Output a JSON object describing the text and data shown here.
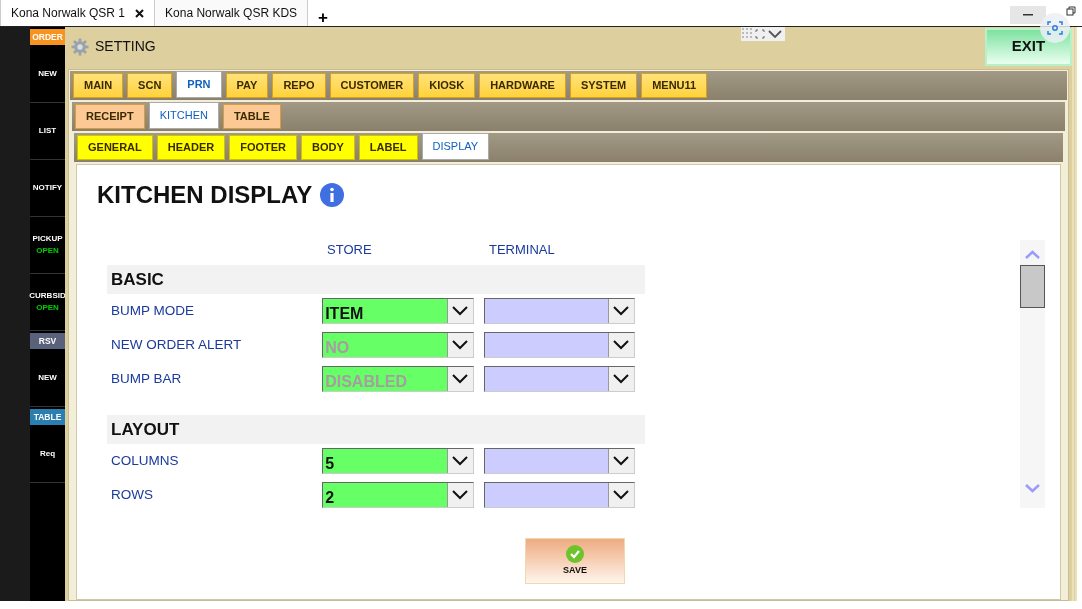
{
  "browser_tabs": [
    {
      "label": "Kona Norwalk QSR 1",
      "selected": true,
      "closable": true
    },
    {
      "label": "Kona Norwalk QSR KDS",
      "selected": false,
      "closable": false
    }
  ],
  "new_tab": "+",
  "sidebar": [
    {
      "label": "ORDER",
      "kind": "tag",
      "color": "#f7931e"
    },
    {
      "label": "NEW",
      "kind": "item"
    },
    {
      "label": "LIST",
      "kind": "item"
    },
    {
      "label": "NOTIFY",
      "kind": "item"
    },
    {
      "label": "PICKUP",
      "kind": "item",
      "sub": "OPEN"
    },
    {
      "label": "CURBSID",
      "kind": "item",
      "sub": "OPEN"
    },
    {
      "label": "RSV",
      "kind": "tag",
      "color": "#59627a"
    },
    {
      "label": "NEW",
      "kind": "item"
    },
    {
      "label": "TABLE",
      "kind": "tag",
      "color": "#2a7fb0"
    },
    {
      "label": "Req",
      "kind": "item"
    }
  ],
  "header": {
    "title": "SETTING",
    "exit": "EXIT"
  },
  "tabs": [
    {
      "label": "MAIN",
      "selected": false
    },
    {
      "label": "SCN",
      "selected": false
    },
    {
      "label": "PRN",
      "selected": true
    },
    {
      "label": "PAY",
      "selected": false
    },
    {
      "label": "REPO",
      "selected": false
    },
    {
      "label": "CUSTOMER",
      "selected": false
    },
    {
      "label": "KIOSK",
      "selected": false
    },
    {
      "label": "HARDWARE",
      "selected": false
    },
    {
      "label": "SYSTEM",
      "selected": false
    },
    {
      "label": "MENU11",
      "selected": false
    }
  ],
  "subtabs": [
    {
      "label": "RECEIPT",
      "selected": false
    },
    {
      "label": "KITCHEN",
      "selected": true
    },
    {
      "label": "TABLE",
      "selected": false
    }
  ],
  "section_tabs": [
    {
      "label": "GENERAL",
      "selected": false
    },
    {
      "label": "HEADER",
      "selected": false
    },
    {
      "label": "FOOTER",
      "selected": false
    },
    {
      "label": "BODY",
      "selected": false
    },
    {
      "label": "LABEL",
      "selected": false
    },
    {
      "label": "DISPLAY",
      "selected": true
    }
  ],
  "page_title": "KITCHEN DISPLAY",
  "columns": [
    "STORE",
    "TERMINAL"
  ],
  "sections": [
    {
      "title": "BASIC",
      "rows": [
        {
          "label": "BUMP MODE",
          "store": "ITEM",
          "dimmed": false
        },
        {
          "label": "NEW ORDER ALERT",
          "store": "NO",
          "dimmed": true
        },
        {
          "label": "BUMP BAR",
          "store": "DISABLED",
          "dimmed": true
        }
      ]
    },
    {
      "title": "LAYOUT",
      "rows": [
        {
          "label": "COLUMNS",
          "store": "5",
          "dimmed": false
        },
        {
          "label": "ROWS",
          "store": "2",
          "dimmed": false
        }
      ]
    }
  ],
  "save": "SAVE"
}
